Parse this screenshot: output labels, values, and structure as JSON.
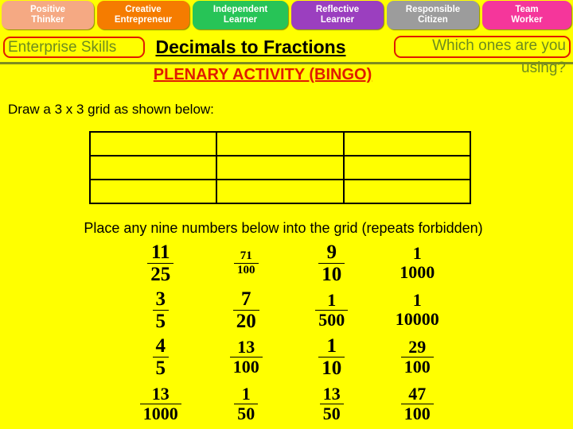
{
  "skill_bar": {
    "tabs": [
      {
        "line1": "Positive",
        "line2": "Thinker",
        "color": "#F5A983"
      },
      {
        "line1": "Creative",
        "line2": "Entrepreneur",
        "color": "#F57C00"
      },
      {
        "line1": "Independent",
        "line2": "Learner",
        "color": "#27C457"
      },
      {
        "line1": "Reflective",
        "line2": "Learner",
        "color": "#9B3FBF"
      },
      {
        "line1": "Responsible",
        "line2": "Citizen",
        "color": "#9C9C9C"
      },
      {
        "line1": "Team",
        "line2": "Worker",
        "color": "#F5369B"
      }
    ]
  },
  "header": {
    "enterprise_label": "Enterprise Skills",
    "title": "Decimals to Fractions",
    "which_line1": "Which ones are you",
    "which_line2": "using?",
    "subtitle": "PLENARY ACTIVITY (BINGO)",
    "accent_red": "#E01B00",
    "accent_green": "#6E8B1E",
    "background": "#FFFF00"
  },
  "body": {
    "instruction_draw": "Draw a 3 x 3 grid as shown below:",
    "instruction_place": "Place any nine numbers below into the grid (repeats forbidden)"
  },
  "bingo_grid": {
    "rows": 3,
    "cols": 3,
    "cells": [
      [
        "",
        "",
        ""
      ],
      [
        "",
        "",
        ""
      ],
      [
        "",
        "",
        ""
      ]
    ]
  },
  "fractions": {
    "rows": [
      [
        {
          "num": "11",
          "den": "25",
          "size": "sz-lg",
          "bar": true
        },
        {
          "num": "71",
          "den": "100",
          "size": "sz-sm",
          "bar": true
        },
        {
          "num": "9",
          "den": "10",
          "size": "sz-lg",
          "bar": true
        },
        {
          "num": "1",
          "den": "1000",
          "size": "sz-md",
          "bar": false
        }
      ],
      [
        {
          "num": "3",
          "den": "5",
          "size": "sz-lg",
          "bar": true
        },
        {
          "num": "7",
          "den": "20",
          "size": "sz-lg",
          "bar": true
        },
        {
          "num": "1",
          "den": "500",
          "size": "sz-md",
          "bar": true
        },
        {
          "num": "1",
          "den": "10000",
          "size": "sz-md",
          "bar": false
        }
      ],
      [
        {
          "num": "4",
          "den": "5",
          "size": "sz-lg",
          "bar": true
        },
        {
          "num": "13",
          "den": "100",
          "size": "sz-md",
          "bar": true
        },
        {
          "num": "1",
          "den": "10",
          "size": "sz-lg",
          "bar": true
        },
        {
          "num": "29",
          "den": "100",
          "size": "sz-md",
          "bar": true
        }
      ],
      [
        {
          "num": "13",
          "den": "1000",
          "size": "sz-md",
          "bar": true
        },
        {
          "num": "1",
          "den": "50",
          "size": "sz-md",
          "bar": true
        },
        {
          "num": "13",
          "den": "50",
          "size": "sz-md",
          "bar": true
        },
        {
          "num": "47",
          "den": "100",
          "size": "sz-md",
          "bar": true
        }
      ]
    ]
  }
}
